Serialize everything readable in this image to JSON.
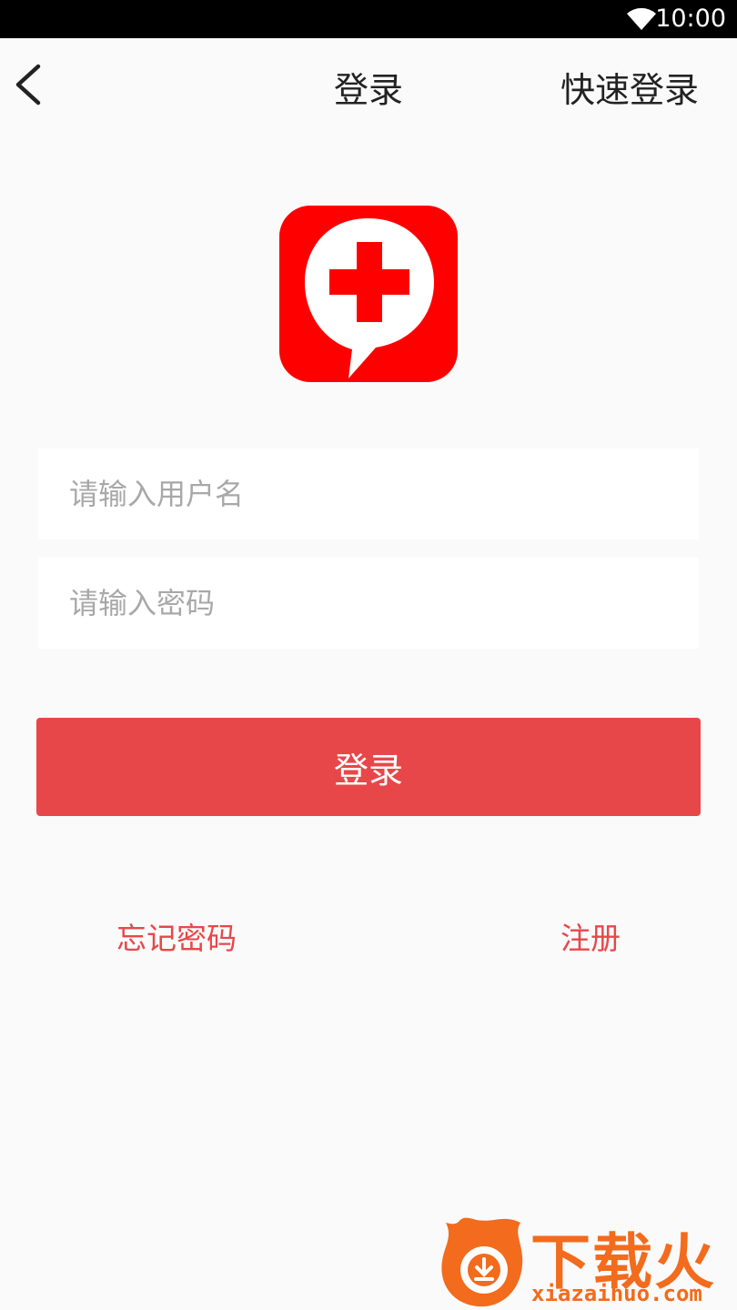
{
  "status_bar": {
    "time": "10:00",
    "wifi_icon": "wifi-icon"
  },
  "nav": {
    "back_icon": "chevron-left-icon",
    "title": "登录",
    "quick_login": "快速登录"
  },
  "logo": {
    "icon": "medical-cross-chat-bubble-icon",
    "color": "#ff0000"
  },
  "form": {
    "username_placeholder": "请输入用户名",
    "password_placeholder": "请输入密码",
    "username_value": "",
    "password_value": ""
  },
  "login_button": {
    "label": "登录",
    "color": "#e84749"
  },
  "links": {
    "forgot_password": "忘记密码",
    "register": "注册"
  },
  "watermark": {
    "brand": "下载火",
    "url": "xiazaihuo.com",
    "color": "#f36b1c"
  }
}
